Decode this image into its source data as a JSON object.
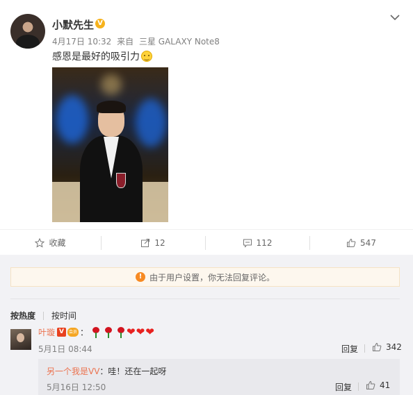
{
  "post": {
    "username": "小默先生",
    "verified_badge": "V",
    "date": "4月17日 10:32",
    "source_prefix": "来自",
    "source_device": "三星 GALAXY Note8",
    "text": "感恩是最好的吸引力",
    "emoji_icon": "smile-emoji",
    "actions": {
      "favorite": "收藏",
      "repost_count": "12",
      "comment_count": "112",
      "like_count": "547"
    }
  },
  "comments_section": {
    "notice": "由于用户设置，你无法回复评论。",
    "sort_hot": "按热度",
    "sort_time": "按时间",
    "comments": [
      {
        "username": "叶璇",
        "badge_v": "V",
        "badge_crown": "会员",
        "colon": "：",
        "content_icons": [
          "rose-emoji",
          "rose-emoji",
          "rose-emoji",
          "heart-emoji",
          "heart-emoji",
          "heart-emoji"
        ],
        "heart": "❤",
        "time": "5月1日 08:44",
        "reply_label": "回复",
        "like_count": "342",
        "sub_reply": {
          "username": "另一个我是VV",
          "text": "：哇！还在一起呀",
          "time": "5月16日 12:50",
          "reply_label": "回复",
          "like_count": "41"
        }
      }
    ]
  },
  "colors": {
    "accent_orange": "#eb7350",
    "warning_orange": "#f78a23",
    "verified_gold": "#f6b21d",
    "page_bg": "#f2f2f5"
  }
}
